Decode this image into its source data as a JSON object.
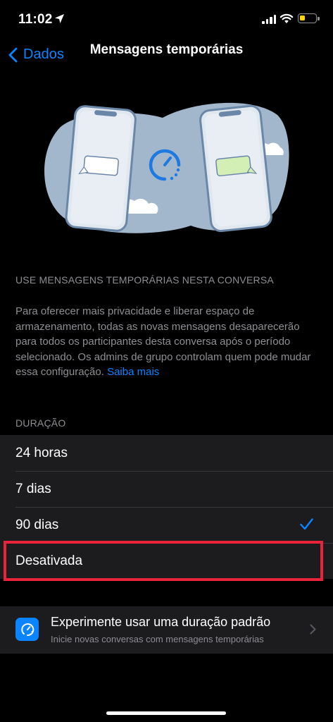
{
  "status_bar": {
    "time": "11:02",
    "icons": [
      "location-arrow-icon",
      "cellular-signal-icon",
      "wifi-icon",
      "battery-icon"
    ],
    "battery_color": "#ffd60a"
  },
  "nav": {
    "back_label": "Dados",
    "title": "Mensagens temporárias"
  },
  "section": {
    "header": "USE MENSAGENS TEMPORÁRIAS NESTA CONVERSA",
    "description": "Para oferecer mais privacidade e liberar espaço de armazenamento, todas as novas mensagens desaparecerão para todos os participantes desta conversa após o período selecionado. Os admins de grupo controlam quem pode mudar essa configuração. ",
    "link": "Saiba mais"
  },
  "duration": {
    "header": "DURAÇÃO",
    "options": [
      {
        "label": "24 horas",
        "selected": false
      },
      {
        "label": "7 dias",
        "selected": false
      },
      {
        "label": "90 dias",
        "selected": true
      },
      {
        "label": "Desativada",
        "selected": false
      }
    ]
  },
  "promo": {
    "title": "Experimente usar uma duração padrão",
    "subtitle": "Inicie novas conversas com mensagens temporárias",
    "icon": "timer-icon"
  },
  "colors": {
    "accent": "#0a84ff",
    "background": "#000000",
    "cell": "#1c1c1e",
    "secondary_text": "#8e8e93",
    "highlight": "#e8233a"
  }
}
